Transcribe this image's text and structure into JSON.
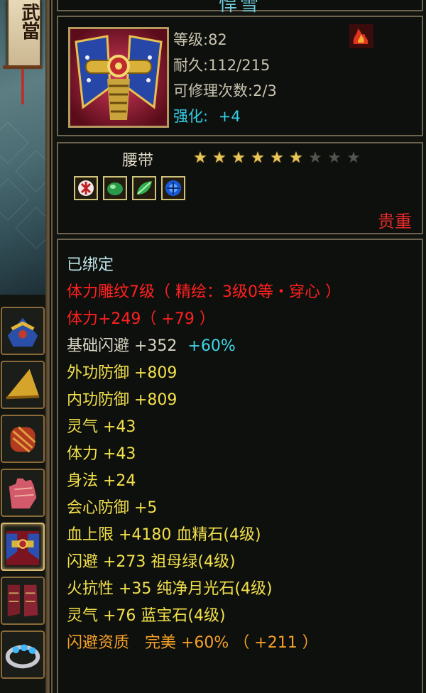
{
  "window": {
    "title": "悍雪",
    "banner": "武當"
  },
  "item": {
    "level_line": "等级:82",
    "durability_line": "耐久:112/215",
    "repair_line": "可修理次数:2/3",
    "enhance_label": "强化:",
    "enhance_value": "+4",
    "type": "腰带",
    "stars_total": 9,
    "stars_filled": 6,
    "quality": "贵重"
  },
  "gems": [
    "red-rune-gem-icon",
    "green-jade-gem-icon",
    "green-leaf-gem-icon",
    "blue-sapphire-gem-icon"
  ],
  "attributes": {
    "bound": "已绑定",
    "engrave": "体力雕纹7级（ 精绘：3级0等・穿心 ）",
    "stamina_main": "体力+249（ +79 ）",
    "base_dodge": "基础闪避 +352",
    "base_dodge_pct": "+60%",
    "ext_def": "外功防御 +809",
    "int_def": "内功防御 +809",
    "spirit": "灵气 +43",
    "stamina": "体力 +43",
    "agility": "身法 +24",
    "crit_def": "会心防御 +5",
    "hp_cap": "血上限 +4180 血精石(4级)",
    "dodge": "闪避 +273 祖母绿(4级)",
    "fire_res": "火抗性 +35 纯净月光石(4级)",
    "spirit_gem": "灵气 +76 蓝宝石(4级)",
    "dodge_quality": "闪避资质　完美 +60% （ +211 ）"
  },
  "colors": {
    "accent_cyan": "#34d0e8",
    "quality_red": "#e62a2a",
    "gem_yellow": "#f2e04c",
    "orange": "#f5a028"
  }
}
